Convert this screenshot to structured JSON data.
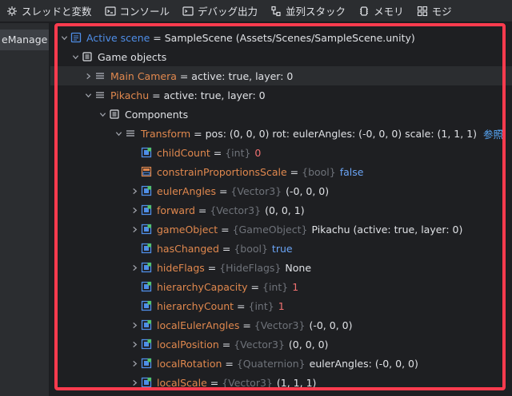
{
  "tabs": [
    {
      "label": "スレッドと変数",
      "icon": "thread-icon"
    },
    {
      "label": "コンソール",
      "icon": "console-icon"
    },
    {
      "label": "デバッグ出力",
      "icon": "debug-output-icon"
    },
    {
      "label": "並列スタック",
      "icon": "parallel-stacks-icon"
    },
    {
      "label": "メモリ",
      "icon": "memory-icon"
    },
    {
      "label": "モジ",
      "icon": "modules-icon"
    }
  ],
  "sidebar": {
    "item": "eManage"
  },
  "tree": {
    "active_scene": {
      "name": "Active scene",
      "eq": " = ",
      "value": "SampleScene (Assets/Scenes/SampleScene.unity)"
    },
    "game_objects": {
      "label": "Game objects"
    },
    "main_camera": {
      "name": "Main Camera",
      "eq": " = ",
      "value": "active: true, layer: 0"
    },
    "pikachu": {
      "name": "Pikachu",
      "eq": " = ",
      "value": "active: true, layer: 0"
    },
    "components": {
      "label": "Components"
    },
    "transform": {
      "name": "Transform",
      "eq": " = ",
      "value": "pos: (0, 0, 0) rot: eulerAngles: (-0, 0, 0) scale: (1, 1, 1)",
      "link": "参照"
    },
    "fields": [
      {
        "name": "childCount",
        "eq": " = ",
        "type": "{int}",
        "value": "0"
      },
      {
        "name": "constrainProportionsScale",
        "eq": " = ",
        "type": "{bool}",
        "value": "false"
      },
      {
        "name": "eulerAngles",
        "eq": " = ",
        "type": "{Vector3}",
        "value": "(-0, 0, 0)"
      },
      {
        "name": "forward",
        "eq": " = ",
        "type": "{Vector3}",
        "value": "(0, 0, 1)"
      },
      {
        "name": "gameObject",
        "eq": " = ",
        "type": "{GameObject}",
        "value": "Pikachu (active: true, layer: 0)"
      },
      {
        "name": "hasChanged",
        "eq": " = ",
        "type": "{bool}",
        "value": "true"
      },
      {
        "name": "hideFlags",
        "eq": " = ",
        "type": "{HideFlags}",
        "value": "None"
      },
      {
        "name": "hierarchyCapacity",
        "eq": " = ",
        "type": "{int}",
        "value": "1"
      },
      {
        "name": "hierarchyCount",
        "eq": " = ",
        "type": "{int}",
        "value": "1"
      },
      {
        "name": "localEulerAngles",
        "eq": " = ",
        "type": "{Vector3}",
        "value": "(-0, 0, 0)"
      },
      {
        "name": "localPosition",
        "eq": " = ",
        "type": "{Vector3}",
        "value": "(0, 0, 0)"
      },
      {
        "name": "localRotation",
        "eq": " = ",
        "type": "{Quaternion}",
        "value": "eulerAngles: (-0, 0, 0)"
      },
      {
        "name": "localScale",
        "eq": " = ",
        "type": "{Vector3}",
        "value": "(1, 1, 1)"
      }
    ]
  },
  "colors": {
    "highlight_border": "#ff3b4e",
    "name_orange": "#e0884e",
    "keyword_blue": "#6aa4f5",
    "number_red": "#f07070"
  }
}
